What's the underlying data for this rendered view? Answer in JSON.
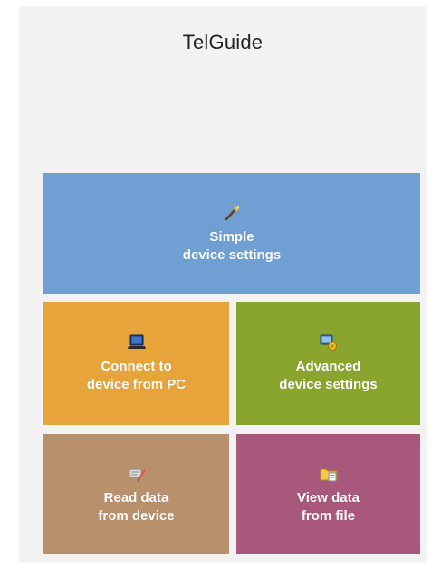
{
  "app": {
    "title": "TelGuide"
  },
  "tiles": [
    {
      "line1": "Simple",
      "line2": "device settings",
      "icon": "wand-icon",
      "color": "#6f9fd3"
    },
    {
      "line1": "Connect to",
      "line2": "device from PC",
      "icon": "laptop-icon",
      "color": "#e6a43a"
    },
    {
      "line1": "Advanced",
      "line2": "device settings",
      "icon": "gear-settings-icon",
      "color": "#8aa52d"
    },
    {
      "line1": "Read data",
      "line2": "from device",
      "icon": "pencil-icon",
      "color": "#b8906c"
    },
    {
      "line1": "View data",
      "line2": "from file",
      "icon": "folder-icon",
      "color": "#a8587a"
    }
  ]
}
